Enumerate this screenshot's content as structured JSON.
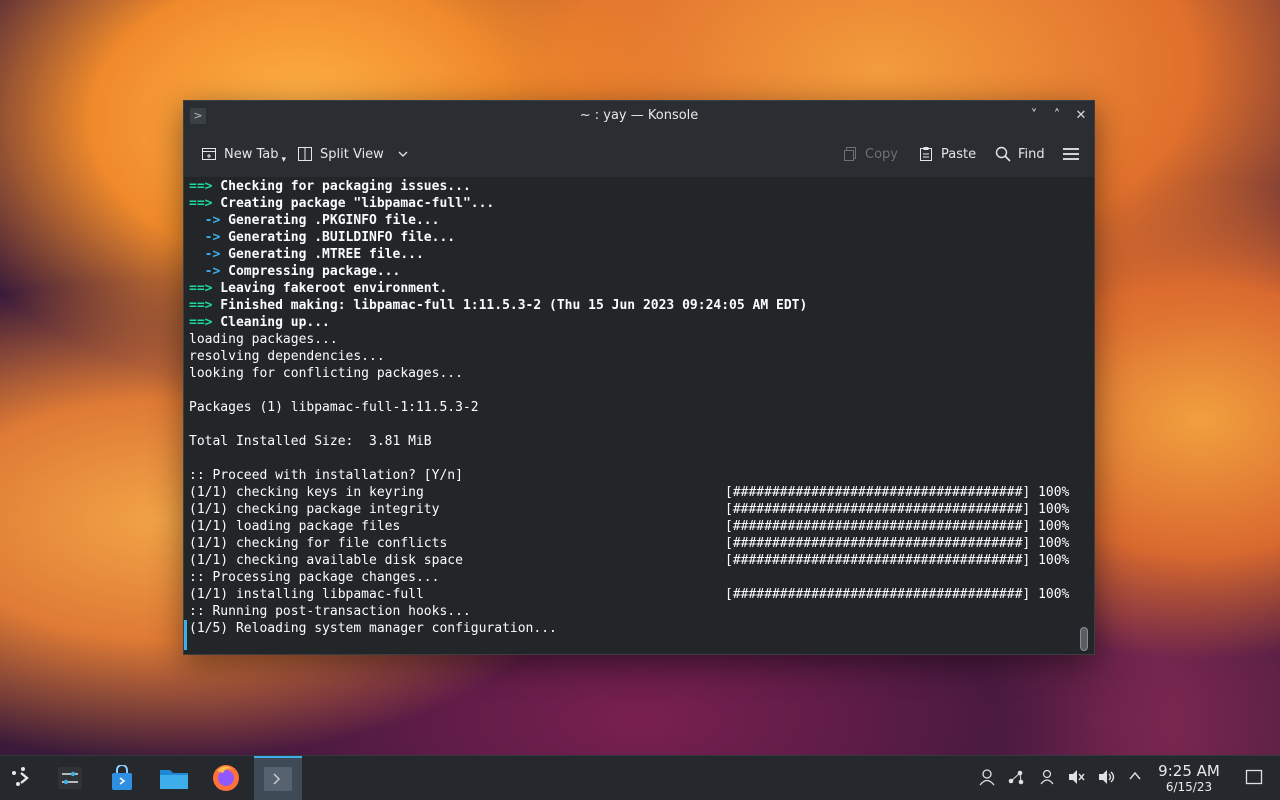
{
  "window": {
    "title": "~ : yay — Konsole",
    "app_icon": "konsole-icon",
    "controls": {
      "minimize": "˅",
      "maximize": "˄",
      "close": "✕"
    }
  },
  "toolbar": {
    "new_tab": "New Tab",
    "split_view": "Split View",
    "copy": "Copy",
    "paste": "Paste",
    "find": "Find"
  },
  "terminal": {
    "lines": [
      {
        "prefix": "==>",
        "text": " Checking for packaging issues..."
      },
      {
        "prefix": "==>",
        "text": " Creating package \"libpamac-full\"..."
      },
      {
        "sub": "  ->",
        "text": " Generating .PKGINFO file..."
      },
      {
        "sub": "  ->",
        "text": " Generating .BUILDINFO file..."
      },
      {
        "sub": "  ->",
        "text": " Generating .MTREE file..."
      },
      {
        "sub": "  ->",
        "text": " Compressing package..."
      },
      {
        "prefix": "==>",
        "text": " Leaving fakeroot environment."
      },
      {
        "prefix": "==>",
        "text": " Finished making: libpamac-full 1:11.5.3-2 (Thu 15 Jun 2023 09:24:05 AM EDT)"
      },
      {
        "prefix": "==>",
        "text": " Cleaning up..."
      },
      {
        "plain": "loading packages..."
      },
      {
        "plain": "resolving dependencies..."
      },
      {
        "plain": "looking for conflicting packages..."
      },
      {
        "plain": ""
      },
      {
        "plain": "Packages (1) libpamac-full-1:11.5.3-2"
      },
      {
        "plain": ""
      },
      {
        "plain": "Total Installed Size:  3.81 MiB"
      },
      {
        "plain": ""
      },
      {
        "plain": ":: Proceed with installation? [Y/n]"
      },
      {
        "plain": "(1/1) checking keys in keyring",
        "progress": "[#####################################] 100%"
      },
      {
        "plain": "(1/1) checking package integrity",
        "progress": "[#####################################] 100%"
      },
      {
        "plain": "(1/1) loading package files",
        "progress": "[#####################################] 100%"
      },
      {
        "plain": "(1/1) checking for file conflicts",
        "progress": "[#####################################] 100%"
      },
      {
        "plain": "(1/1) checking available disk space",
        "progress": "[#####################################] 100%"
      },
      {
        "plain": ":: Processing package changes..."
      },
      {
        "plain": "(1/1) installing libpamac-full",
        "progress": "[#####################################] 100%"
      },
      {
        "plain": ":: Running post-transaction hooks..."
      },
      {
        "plain": "(1/5) Reloading system manager configuration..."
      }
    ]
  },
  "taskbar": {
    "launchers": [
      "application-launcher-icon",
      "system-settings-icon",
      "discover-store-icon",
      "file-manager-icon",
      "firefox-icon",
      "konsole-icon"
    ],
    "tray_icons": [
      "user-icon",
      "network-icon",
      "user-switch-icon",
      "muted-speaker-icon",
      "volume-icon",
      "chevron-up-icon",
      "show-desktop-icon"
    ],
    "clock": {
      "time": "9:25 AM",
      "date": "6/15/23"
    }
  }
}
